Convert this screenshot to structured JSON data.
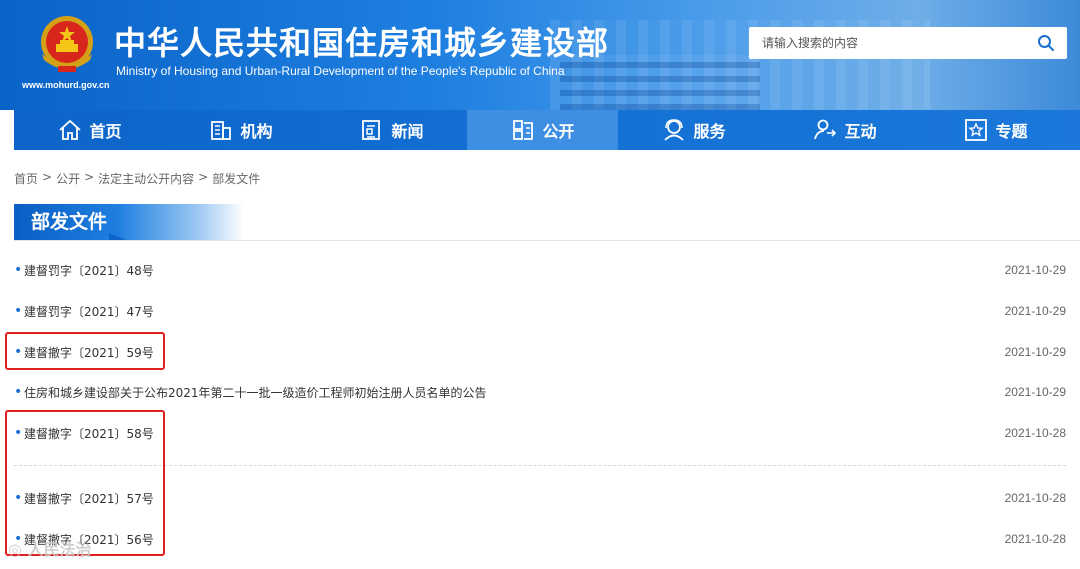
{
  "header": {
    "title": "中华人民共和国住房和城乡建设部",
    "subtitle": "Ministry of Housing and Urban-Rural Development of the People's Republic of China",
    "url": "www.mohurd.gov.cn",
    "search_placeholder": "请输入搜索的内容"
  },
  "nav": [
    {
      "label": "首页",
      "icon": "home-icon"
    },
    {
      "label": "机构",
      "icon": "building-icon"
    },
    {
      "label": "新闻",
      "icon": "news-icon"
    },
    {
      "label": "公开",
      "icon": "disclosure-icon",
      "active": true
    },
    {
      "label": "服务",
      "icon": "service-icon"
    },
    {
      "label": "互动",
      "icon": "interaction-icon"
    },
    {
      "label": "专题",
      "icon": "topic-icon"
    }
  ],
  "breadcrumb": [
    "首页",
    "公开",
    "法定主动公开内容",
    "部发文件"
  ],
  "breadcrumb_sep": ">",
  "section_title": "部发文件",
  "documents": [
    {
      "title": "建督罚字〔2021〕48号",
      "date": "2021-10-29"
    },
    {
      "title": "建督罚字〔2021〕47号",
      "date": "2021-10-29"
    },
    {
      "title": "建督撤字〔2021〕59号",
      "date": "2021-10-29"
    },
    {
      "title": "住房和城乡建设部关于公布2021年第二十一批一级造价工程师初始注册人员名单的公告",
      "date": "2021-10-29"
    },
    {
      "title": "建督撤字〔2021〕58号",
      "date": "2021-10-28"
    },
    {
      "title": "建督撤字〔2021〕57号",
      "date": "2021-10-28"
    },
    {
      "title": "建督撤字〔2021〕56号",
      "date": "2021-10-28"
    }
  ],
  "watermark": "人民法治",
  "colors": {
    "primary": "#0d64c9",
    "highlight": "#e02020",
    "bullet": "#1a6fd0"
  }
}
